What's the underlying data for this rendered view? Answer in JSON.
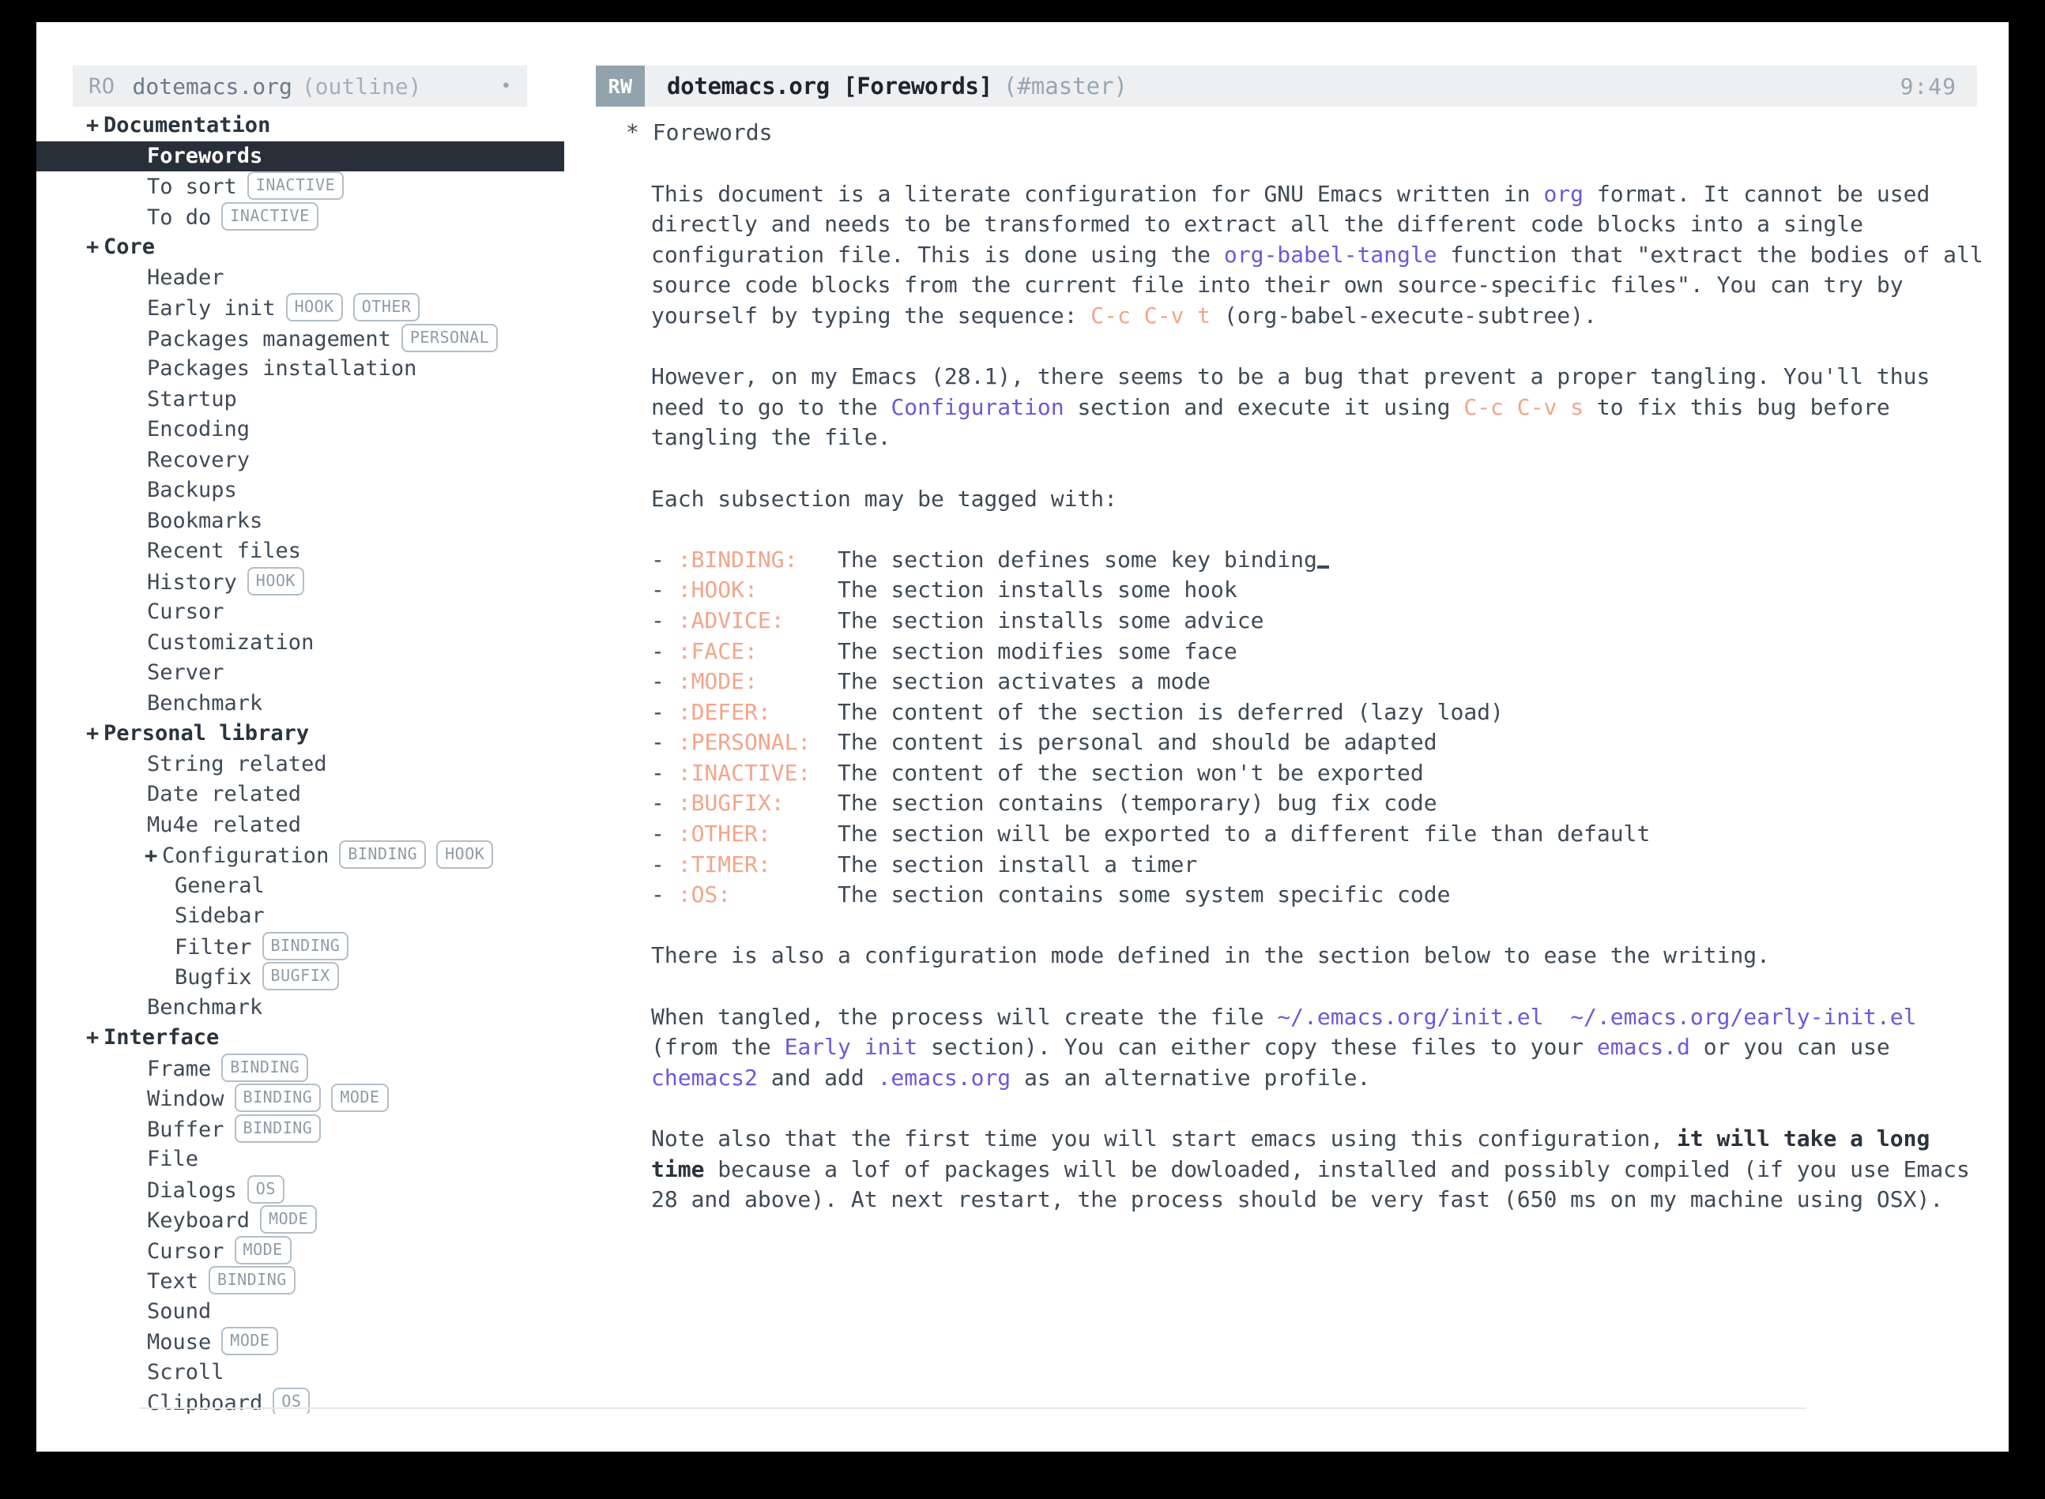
{
  "window": {
    "background": "#000000",
    "page_background": "#ffffff"
  },
  "sidebar": {
    "header": {
      "mode_flag": "RO",
      "filename": "dotemacs.org",
      "mode": "(outline)",
      "indicator": "•"
    },
    "items": [
      {
        "level": 1,
        "bullet": "+",
        "label": "Documentation",
        "tags": [],
        "selected": false
      },
      {
        "level": 2,
        "bullet": "",
        "label": "Forewords",
        "tags": [],
        "selected": true
      },
      {
        "level": 2,
        "bullet": "",
        "label": "To sort",
        "tags": [
          "INACTIVE"
        ],
        "selected": false
      },
      {
        "level": 2,
        "bullet": "",
        "label": "To do",
        "tags": [
          "INACTIVE"
        ],
        "selected": false
      },
      {
        "level": 1,
        "bullet": "+",
        "label": "Core",
        "tags": [],
        "selected": false
      },
      {
        "level": 2,
        "bullet": "",
        "label": "Header",
        "tags": [],
        "selected": false
      },
      {
        "level": 2,
        "bullet": "",
        "label": "Early init",
        "tags": [
          "HOOK",
          "OTHER"
        ],
        "selected": false
      },
      {
        "level": 2,
        "bullet": "",
        "label": "Packages management",
        "tags": [
          "PERSONAL"
        ],
        "selected": false
      },
      {
        "level": 2,
        "bullet": "",
        "label": "Packages installation",
        "tags": [],
        "selected": false
      },
      {
        "level": 2,
        "bullet": "",
        "label": "Startup",
        "tags": [],
        "selected": false
      },
      {
        "level": 2,
        "bullet": "",
        "label": "Encoding",
        "tags": [],
        "selected": false
      },
      {
        "level": 2,
        "bullet": "",
        "label": "Recovery",
        "tags": [],
        "selected": false
      },
      {
        "level": 2,
        "bullet": "",
        "label": "Backups",
        "tags": [],
        "selected": false
      },
      {
        "level": 2,
        "bullet": "",
        "label": "Bookmarks",
        "tags": [],
        "selected": false
      },
      {
        "level": 2,
        "bullet": "",
        "label": "Recent files",
        "tags": [],
        "selected": false
      },
      {
        "level": 2,
        "bullet": "",
        "label": "History",
        "tags": [
          "HOOK"
        ],
        "selected": false
      },
      {
        "level": 2,
        "bullet": "",
        "label": "Cursor",
        "tags": [],
        "selected": false
      },
      {
        "level": 2,
        "bullet": "",
        "label": "Customization",
        "tags": [],
        "selected": false
      },
      {
        "level": 2,
        "bullet": "",
        "label": "Server",
        "tags": [],
        "selected": false
      },
      {
        "level": 2,
        "bullet": "",
        "label": "Benchmark",
        "tags": [],
        "selected": false
      },
      {
        "level": 1,
        "bullet": "+",
        "label": "Personal library",
        "tags": [],
        "selected": false
      },
      {
        "level": 2,
        "bullet": "",
        "label": "String related",
        "tags": [],
        "selected": false
      },
      {
        "level": 2,
        "bullet": "",
        "label": "Date related",
        "tags": [],
        "selected": false
      },
      {
        "level": 2,
        "bullet": "",
        "label": "Mu4e related",
        "tags": [],
        "selected": false
      },
      {
        "level": 3,
        "bullet": "+",
        "label": "Configuration",
        "tags": [
          "BINDING",
          "HOOK"
        ],
        "selected": false
      },
      {
        "level": 4,
        "bullet": "",
        "label": "General",
        "tags": [],
        "selected": false
      },
      {
        "level": 4,
        "bullet": "",
        "label": "Sidebar",
        "tags": [],
        "selected": false
      },
      {
        "level": 4,
        "bullet": "",
        "label": "Filter",
        "tags": [
          "BINDING"
        ],
        "selected": false
      },
      {
        "level": 4,
        "bullet": "",
        "label": "Bugfix",
        "tags": [
          "BUGFIX"
        ],
        "selected": false
      },
      {
        "level": 2,
        "bullet": "",
        "label": "Benchmark",
        "tags": [],
        "selected": false
      },
      {
        "level": 1,
        "bullet": "+",
        "label": "Interface",
        "tags": [],
        "selected": false
      },
      {
        "level": 2,
        "bullet": "",
        "label": "Frame",
        "tags": [
          "BINDING"
        ],
        "selected": false
      },
      {
        "level": 2,
        "bullet": "",
        "label": "Window",
        "tags": [
          "BINDING",
          "MODE"
        ],
        "selected": false
      },
      {
        "level": 2,
        "bullet": "",
        "label": "Buffer",
        "tags": [
          "BINDING"
        ],
        "selected": false
      },
      {
        "level": 2,
        "bullet": "",
        "label": "File",
        "tags": [],
        "selected": false
      },
      {
        "level": 2,
        "bullet": "",
        "label": "Dialogs",
        "tags": [
          "OS"
        ],
        "selected": false
      },
      {
        "level": 2,
        "bullet": "",
        "label": "Keyboard",
        "tags": [
          "MODE"
        ],
        "selected": false
      },
      {
        "level": 2,
        "bullet": "",
        "label": "Cursor",
        "tags": [
          "MODE"
        ],
        "selected": false
      },
      {
        "level": 2,
        "bullet": "",
        "label": "Text",
        "tags": [
          "BINDING"
        ],
        "selected": false
      },
      {
        "level": 2,
        "bullet": "",
        "label": "Sound",
        "tags": [],
        "selected": false
      },
      {
        "level": 2,
        "bullet": "",
        "label": "Mouse",
        "tags": [
          "MODE"
        ],
        "selected": false
      },
      {
        "level": 2,
        "bullet": "",
        "label": "Scroll",
        "tags": [],
        "selected": false
      },
      {
        "level": 2,
        "bullet": "",
        "label": "Clipboard",
        "tags": [
          "OS"
        ],
        "selected": false
      }
    ]
  },
  "main": {
    "header": {
      "mode_flag": "RW",
      "filename": "dotemacs.org",
      "section": "[Forewords]",
      "branch": "(#master)",
      "time": "9:49"
    },
    "outline_heading": "* Forewords",
    "paragraph1": {
      "seg1": "This document is a literate configuration for GNU Emacs written in ",
      "link1": "org",
      "seg2": " format. It cannot be used directly and needs to be transformed to extract all the different code blocks into a single configuration file. This is done using the ",
      "link2": "org-babel-tangle",
      "seg3": " function that \"extract the bodies of all source code blocks from the current file into their own source-specific files\". You can try by yourself by typing the sequence: ",
      "key1": "C-c C-v t",
      "seg4": " (org-babel-execute-subtree)."
    },
    "paragraph2": {
      "seg1": "However, on my Emacs (28.1), there seems to be a bug that prevent a proper tangling. You'll thus need to go to the ",
      "link1": "Configuration",
      "seg2": " section and execute it using ",
      "key1": "C-c C-v s",
      "seg3": " to fix this bug before tangling the file."
    },
    "tag_intro": "Each subsection may be tagged with:",
    "tag_rows": [
      {
        "bullet": "-",
        "tag": ":BINDING:",
        "pad": "  ",
        "desc": "The section defines some key binding",
        "cursor": true
      },
      {
        "bullet": "-",
        "tag": ":HOOK:",
        "pad": "     ",
        "desc": "The section installs some hook",
        "cursor": false
      },
      {
        "bullet": "-",
        "tag": ":ADVICE:",
        "pad": "   ",
        "desc": "The section installs some advice",
        "cursor": false
      },
      {
        "bullet": "-",
        "tag": ":FACE:",
        "pad": "     ",
        "desc": "The section modifies some face",
        "cursor": false
      },
      {
        "bullet": "-",
        "tag": ":MODE:",
        "pad": "     ",
        "desc": "The section activates a mode",
        "cursor": false
      },
      {
        "bullet": "-",
        "tag": ":DEFER:",
        "pad": "    ",
        "desc": "The content of the section is deferred (lazy load)",
        "cursor": false
      },
      {
        "bullet": "-",
        "tag": ":PERSONAL:",
        "pad": " ",
        "desc": "The content is personal and should be adapted",
        "cursor": false
      },
      {
        "bullet": "-",
        "tag": ":INACTIVE:",
        "pad": " ",
        "desc": "The content of the section won't be exported",
        "cursor": false
      },
      {
        "bullet": "-",
        "tag": ":BUGFIX:",
        "pad": "   ",
        "desc": "The section contains (temporary) bug fix code",
        "cursor": false
      },
      {
        "bullet": "-",
        "tag": ":OTHER:",
        "pad": "    ",
        "desc": "The section will be exported to a different file than default",
        "cursor": false
      },
      {
        "bullet": "-",
        "tag": ":TIMER:",
        "pad": "    ",
        "desc": "The section install a timer",
        "cursor": false
      },
      {
        "bullet": "-",
        "tag": ":OS:",
        "pad": "       ",
        "desc": "The section contains some system specific code",
        "cursor": false
      }
    ],
    "paragraph3": "There is also a configuration mode defined in the section below to ease the writing.",
    "paragraph4": {
      "seg1": "When tangled, the process will create the file ",
      "link1": "~/.emacs.org/init.el",
      "seg2": "  ",
      "link2": "~/.emacs.org/early-init.el",
      "seg3": " (from the ",
      "link3": "Early init",
      "seg4": " section). You can either copy these files to your ",
      "link4": "emacs.d",
      "seg5": " or you can use ",
      "link5": "chemacs2",
      "seg6": " and add ",
      "link6": ".emacs.org",
      "seg7": " as an alternative profile."
    },
    "paragraph5": {
      "seg1": "Note also that the first time you will start emacs using this configuration, ",
      "bold1": "it will take a long time",
      "seg2": " because a lof of packages will be dowloaded, installed and possibly compiled (if you use Emacs 28 and above). At next restart, the process should be very fast (650 ms on my machine using OSX)."
    }
  },
  "colors": {
    "accent_link": "#6f57d8",
    "accent_key": "#f3a58a",
    "header_bg": "#edeff1",
    "selected_bg": "#282f38",
    "badge_bg": "#93a3ae",
    "text": "#3f4a56"
  }
}
